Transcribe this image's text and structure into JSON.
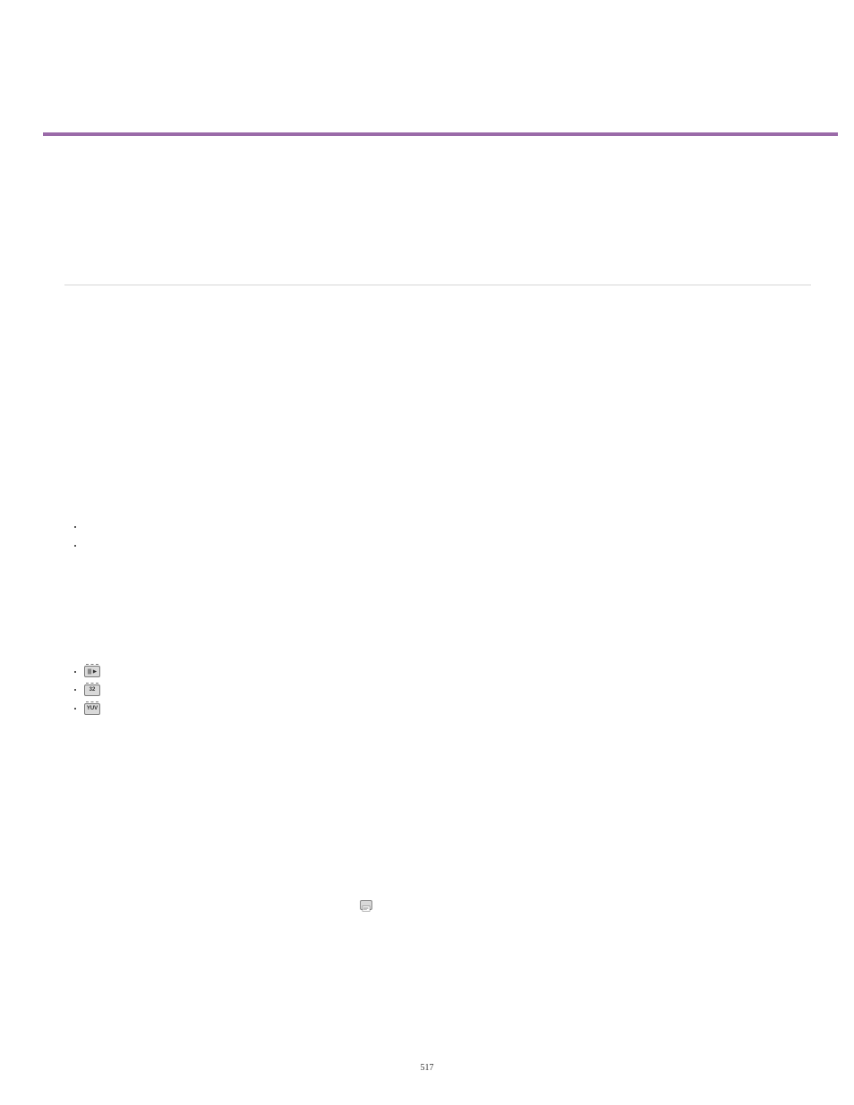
{
  "page": {
    "number": "517"
  },
  "icons": {
    "play_label": "",
    "thirtytwo_label": "32",
    "yuv_label": "YUV"
  }
}
